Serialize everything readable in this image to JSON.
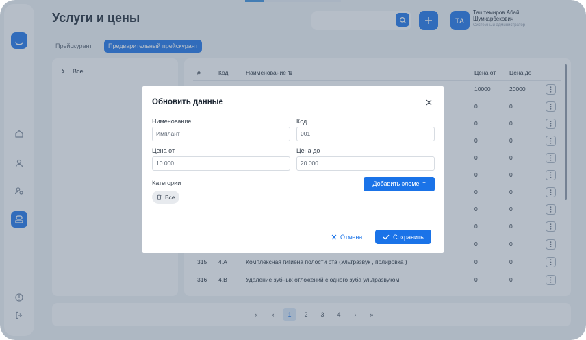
{
  "page": {
    "title": "Услуги и цены"
  },
  "header": {
    "search_placeholder": "",
    "user_initials": "ТА",
    "user_name": "Таштемиров Абай Шумкарбекович",
    "user_role": "Системный администратор"
  },
  "tabs": [
    {
      "label": "Прейскурант",
      "active": false
    },
    {
      "label": "Предварительный прейскурант",
      "active": true
    }
  ],
  "tree": {
    "root_label": "Все"
  },
  "table": {
    "headers": {
      "num": "#",
      "code": "Код",
      "name": "Наименование ⇅",
      "price_from": "Цена от",
      "price_to": "Цена до"
    },
    "rows": [
      {
        "num": "",
        "code": "",
        "name": "",
        "price_from": "10000",
        "price_to": "20000"
      },
      {
        "num": "",
        "code": "",
        "name": "",
        "price_from": "0",
        "price_to": "0"
      },
      {
        "num": "",
        "code": "",
        "name": "",
        "price_from": "0",
        "price_to": "0"
      },
      {
        "num": "",
        "code": "",
        "name": "",
        "price_from": "0",
        "price_to": "0"
      },
      {
        "num": "",
        "code": "",
        "name": "",
        "price_from": "0",
        "price_to": "0"
      },
      {
        "num": "",
        "code": "",
        "name": "",
        "price_from": "0",
        "price_to": "0"
      },
      {
        "num": "",
        "code": "",
        "name": "",
        "price_from": "0",
        "price_to": "0"
      },
      {
        "num": "",
        "code": "",
        "name": "",
        "price_from": "0",
        "price_to": "0"
      },
      {
        "num": "",
        "code": "",
        "name": "",
        "price_from": "0",
        "price_to": "0"
      },
      {
        "num": "",
        "code": "",
        "name": "",
        "price_from": "0",
        "price_to": "0"
      },
      {
        "num": "315",
        "code": "4.A",
        "name": "Комплексная гигиена полости рта (Ультразвук , полировка )",
        "price_from": "0",
        "price_to": "0"
      },
      {
        "num": "316",
        "code": "4.B",
        "name": "Удаление зубных отложений с одного зуба ультразвуком",
        "price_from": "0",
        "price_to": "0"
      }
    ]
  },
  "pagination": {
    "first": "«",
    "prev": "‹",
    "next": "›",
    "last": "»",
    "pages": [
      "1",
      "2",
      "3",
      "4"
    ],
    "current": "1"
  },
  "modal": {
    "title": "Обновить данные",
    "name_label": "Нименование",
    "name_value": "Имплант",
    "code_label": "Код",
    "code_value": "001",
    "price_from_label": "Цена от",
    "price_from_value": "10 000",
    "price_to_label": "Цена до",
    "price_to_value": "20 000",
    "categories_label": "Категории",
    "category_chip": "Все",
    "add_element_label": "Добавить элемент",
    "cancel_label": "Отмена",
    "save_label": "Сохранить"
  },
  "colors": {
    "accent": "#1a73e8",
    "background": "#f2f4f7",
    "overlay": "#52647d"
  },
  "icons": {
    "sidebar": [
      "home-icon",
      "user-icon",
      "users-icon",
      "services-icon",
      "info-icon",
      "logout-icon"
    ],
    "header": [
      "search-icon",
      "plus-icon"
    ],
    "table": [
      "more-vertical-icon"
    ],
    "modal": [
      "close-icon",
      "trash-icon",
      "x-icon",
      "check-icon"
    ]
  }
}
